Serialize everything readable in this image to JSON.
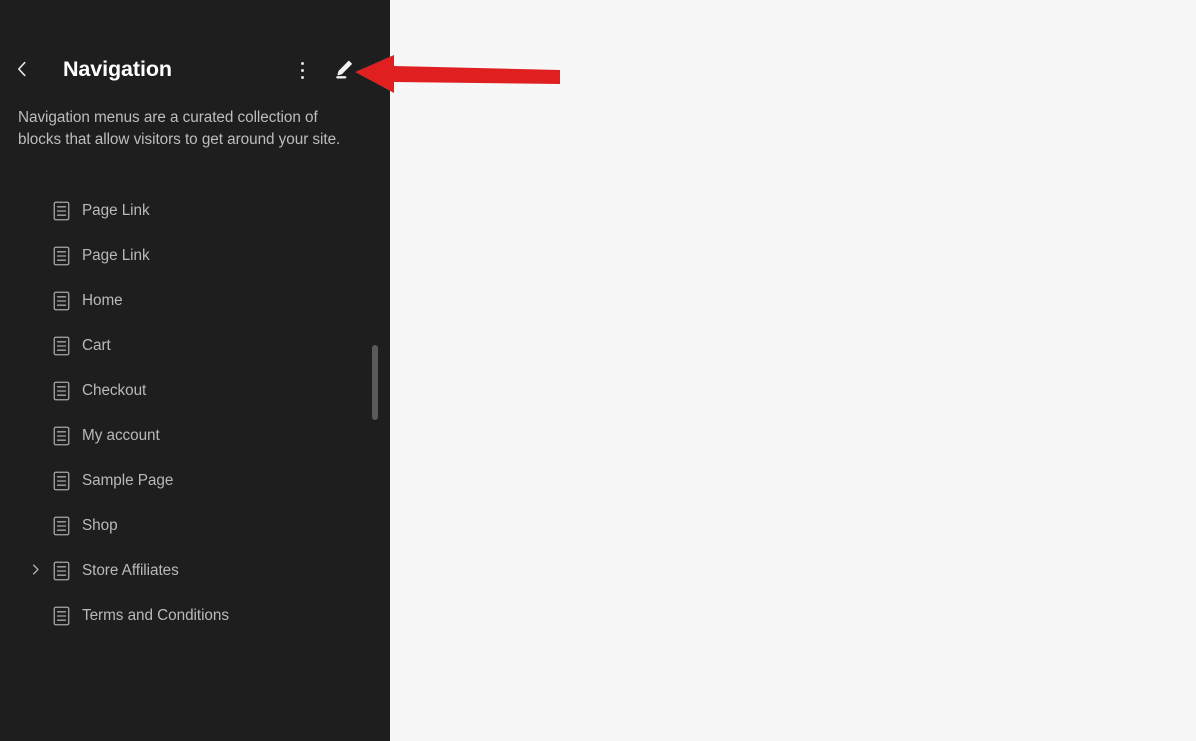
{
  "theme": {
    "sidebar_bg": "#1e1e1e",
    "canvas_bg": "#f7f7f7",
    "title_color": "#ffffff",
    "text_color": "#bdbdbd",
    "item_color": "#b9b9b9",
    "scrollbar_color": "#5a5a5a",
    "annotation_color": "#e02020"
  },
  "header": {
    "title": "Navigation",
    "back_icon": "chevron-left-icon",
    "more_icon": "kebab-menu-icon",
    "edit_icon": "pencil-icon"
  },
  "description": "Navigation menus are a curated collection of blocks that allow visitors to get around your site.",
  "list": {
    "items": [
      {
        "label": "Page Link",
        "icon": "page-document-icon",
        "expandable": false
      },
      {
        "label": "Page Link",
        "icon": "page-document-icon",
        "expandable": false
      },
      {
        "label": "Home",
        "icon": "page-document-icon",
        "expandable": false
      },
      {
        "label": "Cart",
        "icon": "page-document-icon",
        "expandable": false
      },
      {
        "label": "Checkout",
        "icon": "page-document-icon",
        "expandable": false
      },
      {
        "label": "My account",
        "icon": "page-document-icon",
        "expandable": false
      },
      {
        "label": "Sample Page",
        "icon": "page-document-icon",
        "expandable": false
      },
      {
        "label": "Shop",
        "icon": "page-document-icon",
        "expandable": false
      },
      {
        "label": "Store Affiliates",
        "icon": "page-document-icon",
        "expandable": true
      },
      {
        "label": "Terms and Conditions",
        "icon": "page-document-icon",
        "expandable": false
      }
    ]
  },
  "scrollbar": {
    "name": "list-scrollbar"
  },
  "annotation": {
    "name": "red-arrow-annotation",
    "points_to": "edit-button"
  }
}
